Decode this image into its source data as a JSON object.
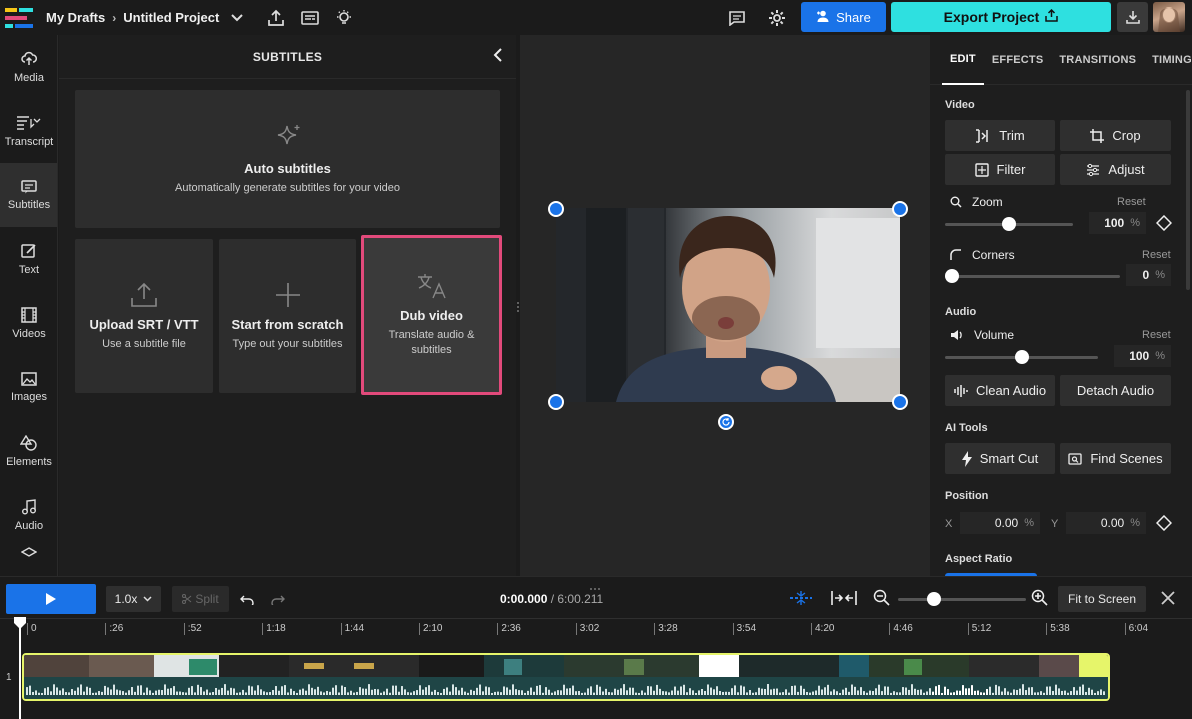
{
  "header": {
    "breadcrumb_root": "My Drafts",
    "project_name": "Untitled Project",
    "share_label": "Share",
    "export_label": "Export Project"
  },
  "sidebar": {
    "items": [
      {
        "label": "Media",
        "icon": "cloud-upload-icon"
      },
      {
        "label": "Transcript",
        "icon": "transcript-icon"
      },
      {
        "label": "Subtitles",
        "icon": "subtitles-icon"
      },
      {
        "label": "Text",
        "icon": "text-icon"
      },
      {
        "label": "Videos",
        "icon": "film-icon"
      },
      {
        "label": "Images",
        "icon": "image-icon"
      },
      {
        "label": "Elements",
        "icon": "shapes-icon"
      },
      {
        "label": "Audio",
        "icon": "music-note-icon"
      }
    ]
  },
  "panel": {
    "title": "SUBTITLES",
    "cards": {
      "auto": {
        "title": "Auto subtitles",
        "subtitle": "Automatically generate subtitles for your video"
      },
      "upload": {
        "title": "Upload SRT / VTT",
        "subtitle": "Use a subtitle file"
      },
      "scratch": {
        "title": "Start from scratch",
        "subtitle": "Type out your subtitles"
      },
      "dub": {
        "title": "Dub video",
        "subtitle": "Translate audio & subtitles"
      }
    }
  },
  "props": {
    "tabs": [
      "EDIT",
      "EFFECTS",
      "TRANSITIONS",
      "TIMING"
    ],
    "active_tab": "EDIT",
    "video_section": "Video",
    "trim": "Trim",
    "crop": "Crop",
    "filter": "Filter",
    "adjust": "Adjust",
    "zoom_label": "Zoom",
    "zoom_value": "100",
    "zoom_level": 1.0,
    "corners_label": "Corners",
    "corners_value": "0",
    "corners_level": 0,
    "audio_section": "Audio",
    "volume_label": "Volume",
    "volume_value": "100",
    "volume_level": 1.0,
    "clean_audio": "Clean Audio",
    "detach_audio": "Detach Audio",
    "ai_section": "AI Tools",
    "smart_cut": "Smart Cut",
    "find_scenes": "Find Scenes",
    "position_section": "Position",
    "x_label": "X",
    "x_value": "0.00",
    "y_label": "Y",
    "y_value": "0.00",
    "aspect_section": "Aspect Ratio",
    "reset": "Reset",
    "percent": "%"
  },
  "timeline": {
    "speed": "1.0x",
    "split": "Split",
    "current_time": "0:00.000",
    "total_time": "/ 6:00.211",
    "fit_label": "Fit to Screen",
    "zoom_level": 0.25,
    "track_number": "1",
    "ruler_ticks": [
      "0",
      ":26",
      ":52",
      "1:18",
      "1:44",
      "2:10",
      "2:36",
      "3:02",
      "3:28",
      "3:54",
      "4:20",
      "4:46",
      "5:12",
      "5:38",
      "6:04"
    ]
  },
  "colors": {
    "accent_blue": "#1a73e8",
    "export_cyan": "#2ee0e0",
    "selection_pink": "#e24a7b",
    "clip_outline": "#e6f56a"
  }
}
